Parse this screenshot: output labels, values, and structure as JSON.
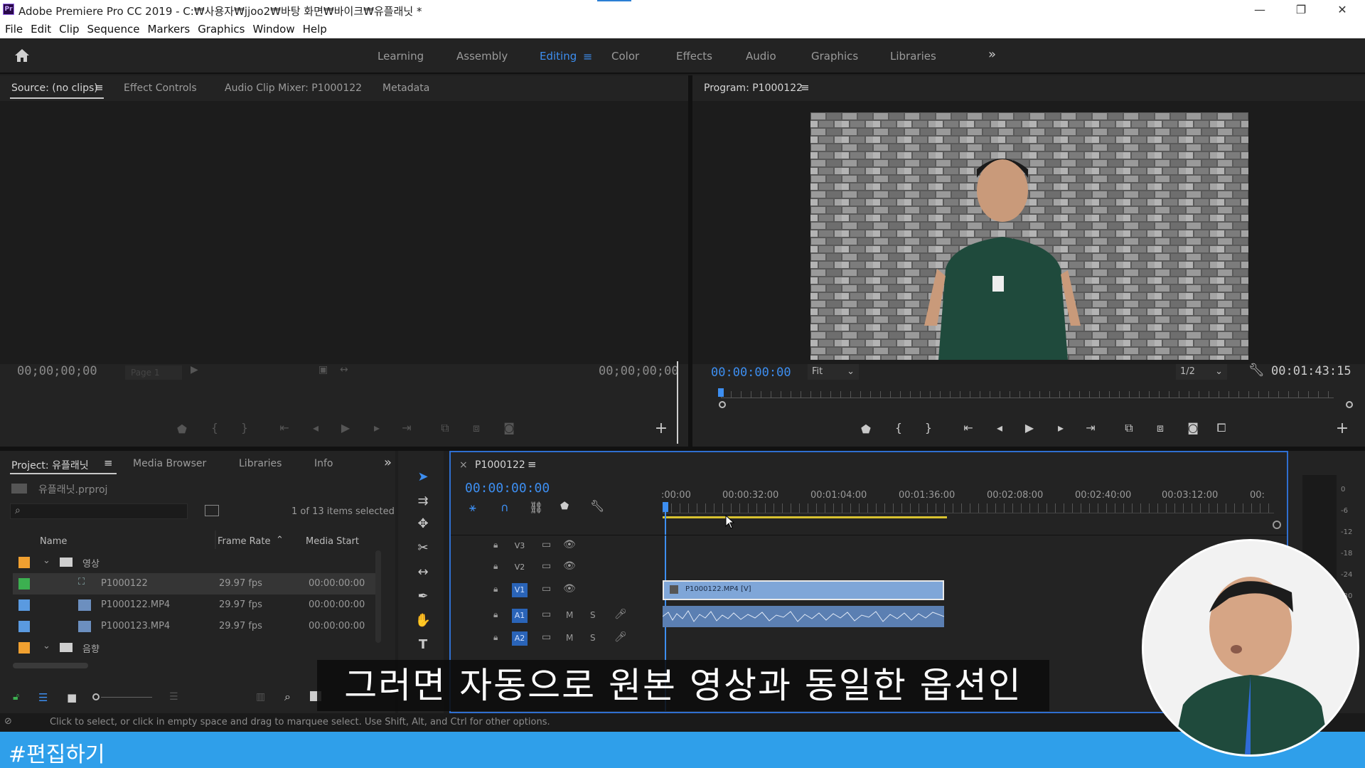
{
  "window": {
    "title": "Adobe Premiere Pro CC 2019 - C:₩사용자₩jjoo2₩바탕 화면₩바이크₩유플래닛 *",
    "app_icon_text": "Pr",
    "minimize": "—",
    "maximize": "❐",
    "close": "✕"
  },
  "menu": [
    "File",
    "Edit",
    "Clip",
    "Sequence",
    "Markers",
    "Graphics",
    "Window",
    "Help"
  ],
  "workspaces": {
    "items": [
      "Learning",
      "Assembly",
      "Editing",
      "Color",
      "Effects",
      "Audio",
      "Graphics",
      "Libraries"
    ],
    "active": "Editing",
    "more": "»"
  },
  "source_panel": {
    "tabs": [
      "Source: (no clips)",
      "Effect Controls",
      "Audio Clip Mixer: P1000122",
      "Metadata"
    ],
    "timecode_left": "00;00;00;00",
    "timecode_right": "00;00;00;00",
    "page_select": "Page 1"
  },
  "program_panel": {
    "tab": "Program: P1000122",
    "timecode": "00:00:00:00",
    "fit": "Fit",
    "resolution": "1/2",
    "duration": "00:01:43:15"
  },
  "project_panel": {
    "tabs": [
      "Project: 유플래닛",
      "Media Browser",
      "Libraries",
      "Info"
    ],
    "file": "유플래닛.prproj",
    "selection_info": "1 of 13 items selected",
    "columns": [
      "Name",
      "Frame Rate",
      "Media Start"
    ],
    "rows": [
      {
        "color": "#f0a030",
        "name": "영상",
        "frame_rate": "",
        "media_start": "",
        "type": "folder"
      },
      {
        "color": "#3cb050",
        "name": "P1000122",
        "frame_rate": "29.97 fps",
        "media_start": "00:00:00:00",
        "type": "sequence"
      },
      {
        "color": "#5a9ae0",
        "name": "P1000122.MP4",
        "frame_rate": "29.97 fps",
        "media_start": "00:00:00:00",
        "type": "clip"
      },
      {
        "color": "#5a9ae0",
        "name": "P1000123.MP4",
        "frame_rate": "29.97 fps",
        "media_start": "00:00:00:00",
        "type": "clip"
      },
      {
        "color": "#f0a030",
        "name": "음향",
        "frame_rate": "",
        "media_start": "",
        "type": "folder"
      }
    ]
  },
  "timeline": {
    "tab": "P1000122",
    "timecode": "00:00:00:00",
    "ruler": [
      ":00:00",
      "00:00:32:00",
      "00:01:04:00",
      "00:01:36:00",
      "00:02:08:00",
      "00:02:40:00",
      "00:03:12:00",
      "00:"
    ],
    "tracks": [
      {
        "id": "V3",
        "kind": "video"
      },
      {
        "id": "V2",
        "kind": "video"
      },
      {
        "id": "V1",
        "kind": "video",
        "active": true
      },
      {
        "id": "A1",
        "kind": "audio",
        "active": true
      },
      {
        "id": "A2",
        "kind": "audio",
        "active": true
      }
    ],
    "mute_label": "M",
    "solo_label": "S",
    "video_clip": "P1000122.MP4 [V]",
    "meter_ticks": [
      "0",
      "-6",
      "-12",
      "-18",
      "-24",
      "-30"
    ]
  },
  "status_bar": "Click to select, or click in empty space and drag to marquee select. Use Shift, Alt, and Ctrl for other options.",
  "overlay": {
    "subtitle": "그러면 자동으로 원본 영상과 동일한 옵션인",
    "hashtag": "#편집하기"
  }
}
